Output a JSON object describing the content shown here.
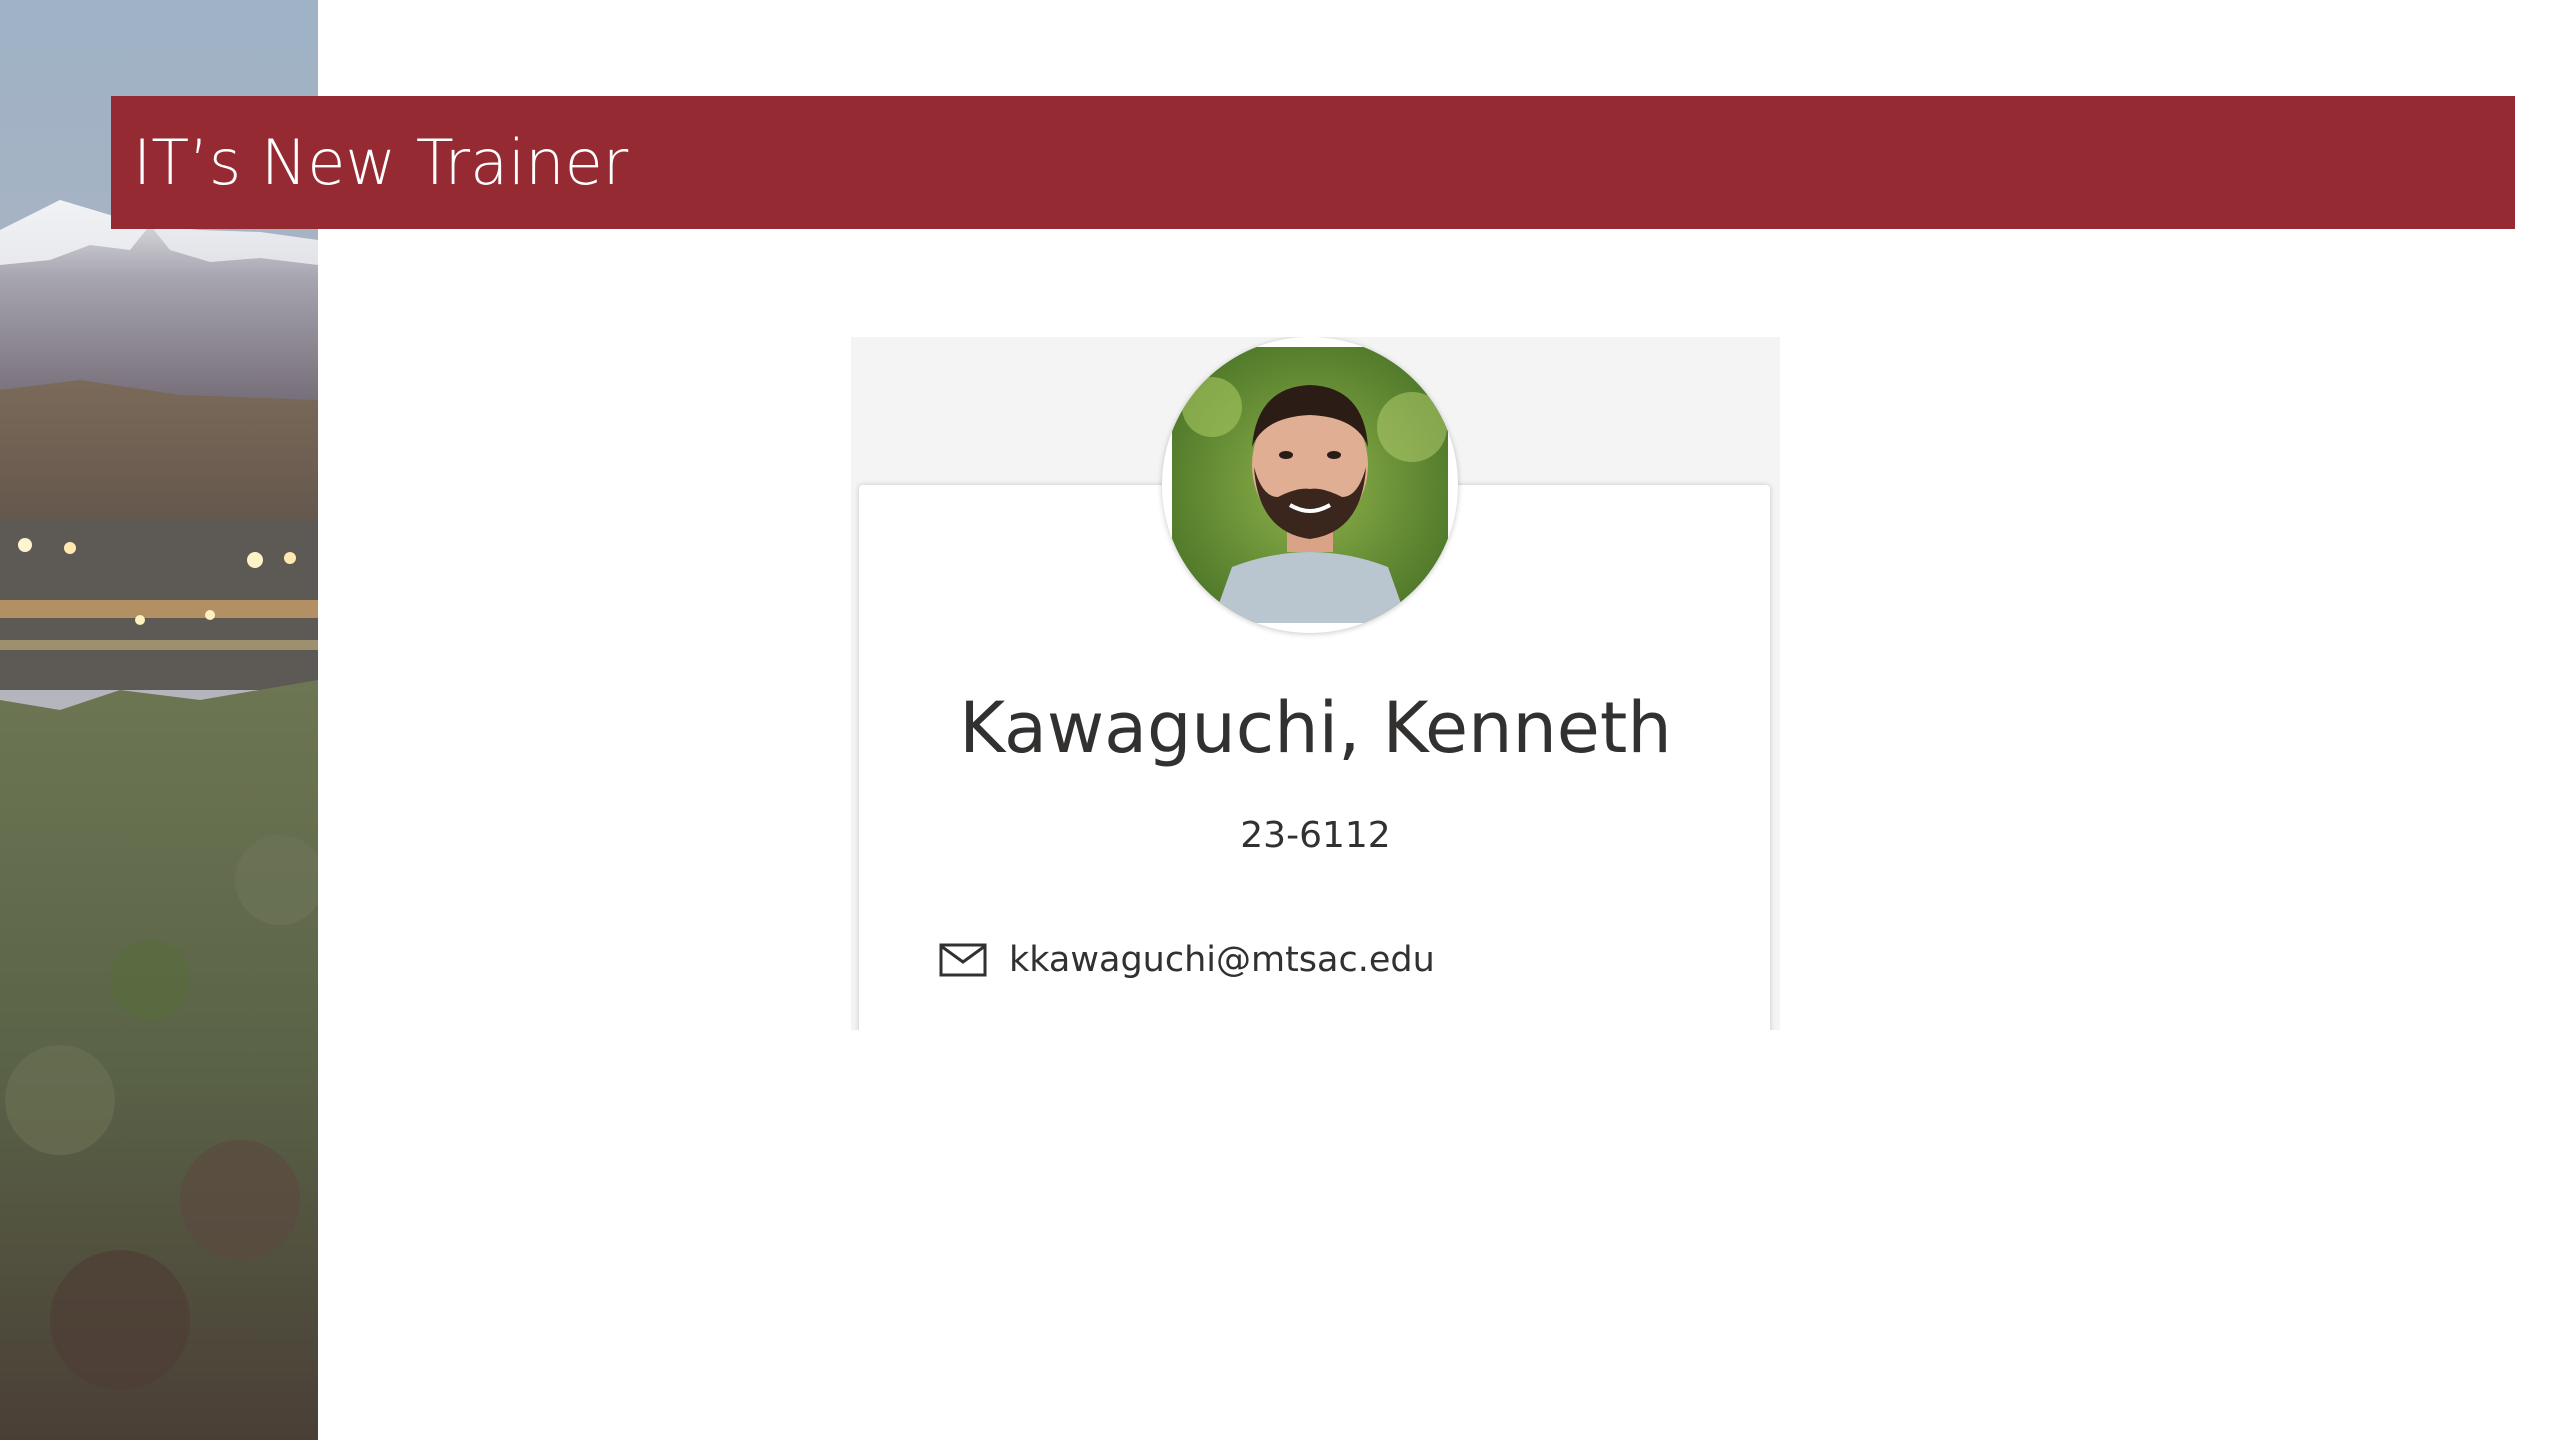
{
  "slide": {
    "title": "IT’s New Trainer"
  },
  "profile_card": {
    "name": "Kawaguchi, Kenneth",
    "phone": "23-6112",
    "email": "kkawaguchi@mtsac.edu",
    "email_icon": "mail-icon"
  },
  "colors": {
    "title_bar": "#952a32",
    "title_text": "#ffffff",
    "card_text": "#323130"
  }
}
